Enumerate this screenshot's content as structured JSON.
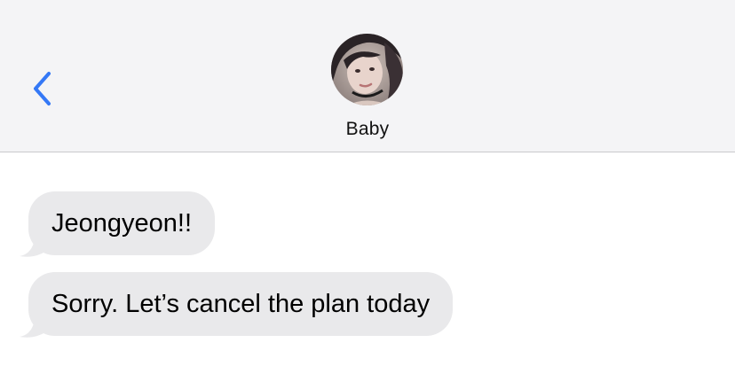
{
  "header": {
    "back_icon": "chevron-left-icon",
    "contact_name": "Baby",
    "accent_color": "#3478f6"
  },
  "messages": [
    {
      "direction": "incoming",
      "text": "Jeongyeon!!"
    },
    {
      "direction": "incoming",
      "text": "Sorry. Let’s cancel the plan today"
    }
  ],
  "colors": {
    "header_bg": "#f4f4f6",
    "incoming_bubble": "#e9e9eb",
    "text": "#000000"
  }
}
